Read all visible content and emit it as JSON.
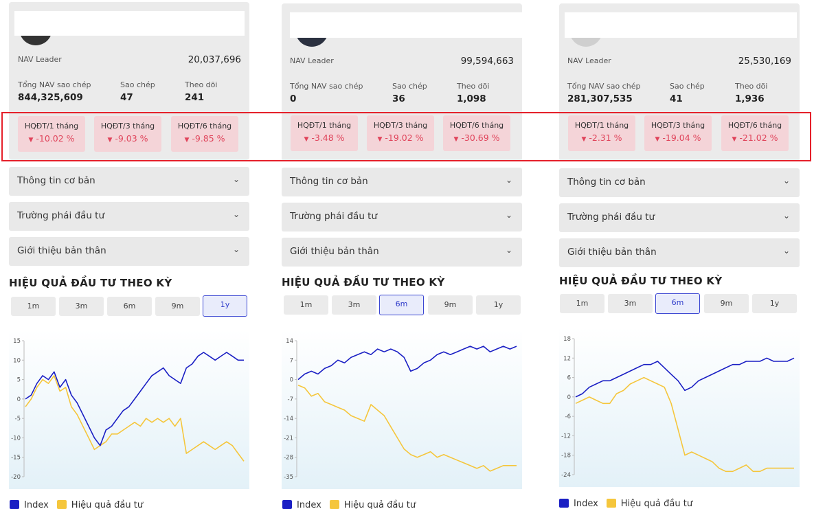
{
  "colors": {
    "index": "#1a1fc4",
    "hqdt": "#f5c63c",
    "negative": "#e0445b",
    "active": "#3b46d2",
    "highlight": "#e5202a"
  },
  "labels": {
    "nav_leader": "NAV Leader",
    "total_nav": "Tổng NAV sao chép",
    "copies": "Sao chép",
    "followers": "Theo dõi",
    "hq1": "HQĐT/1 tháng",
    "hq3": "HQĐT/3 tháng",
    "hq6": "HQĐT/6 tháng",
    "acc_basic": "Thông tin cơ bản",
    "acc_style": "Trường phái đầu tư",
    "acc_intro": "Giới thiệu bản thân",
    "section_title": "HIỆU QUẢ ĐẦU TƯ THEO KỲ",
    "legend_index": "Index",
    "legend_hqdt": "Hiệu quả đầu tư",
    "chevron": "⌄",
    "down_arrow": "▼"
  },
  "periods": [
    "1m",
    "3m",
    "6m",
    "9m",
    "1y"
  ],
  "leaders": [
    {
      "nav_leader": "20,037,696",
      "total_nav": "844,325,609",
      "copies": "47",
      "followers": "241",
      "hq1": "-10.02 %",
      "hq3": "-9.03 %",
      "hq6": "-9.85 %",
      "active_period": "1y"
    },
    {
      "nav_leader": "99,594,663",
      "total_nav": "0",
      "copies": "36",
      "followers": "1,098",
      "hq1": "-3.48 %",
      "hq3": "-19.02 %",
      "hq6": "-30.69 %",
      "active_period": "6m"
    },
    {
      "nav_leader": "25,530,169",
      "total_nav": "281,307,535",
      "copies": "41",
      "followers": "1,936",
      "hq1": "-2.31 %",
      "hq3": "-19.04 %",
      "hq6": "-21.02 %",
      "active_period": "6m"
    }
  ],
  "chart_data": [
    {
      "type": "line",
      "ylim": [
        -20,
        15
      ],
      "yticks": [
        15,
        10,
        5,
        0,
        -5,
        -10,
        -15,
        -20
      ],
      "series": [
        {
          "name": "Index",
          "values": [
            0,
            1,
            4,
            6,
            5,
            7,
            3,
            5,
            1,
            -1,
            -4,
            -7,
            -10,
            -12,
            -8,
            -7,
            -5,
            -3,
            -2,
            0,
            2,
            4,
            6,
            7,
            8,
            6,
            5,
            4,
            8,
            9,
            11,
            12,
            11,
            10,
            11,
            12,
            11,
            10,
            10
          ]
        },
        {
          "name": "Hiệu quả đầu tư",
          "values": [
            -2,
            0,
            3,
            5,
            4,
            6,
            2,
            3,
            -2,
            -4,
            -7,
            -10,
            -13,
            -12,
            -11,
            -9,
            -9,
            -8,
            -7,
            -6,
            -7,
            -5,
            -6,
            -5,
            -6,
            -5,
            -7,
            -5,
            -14,
            -13,
            -12,
            -11,
            -12,
            -13,
            -12,
            -11,
            -12,
            -14,
            -16
          ]
        }
      ]
    },
    {
      "type": "line",
      "ylim": [
        -35,
        14
      ],
      "yticks": [
        14,
        7,
        0,
        -7,
        -14,
        -21,
        -28,
        -35
      ],
      "series": [
        {
          "name": "Index",
          "values": [
            0,
            2,
            3,
            2,
            4,
            5,
            7,
            6,
            8,
            9,
            10,
            9,
            11,
            10,
            11,
            10,
            8,
            3,
            4,
            6,
            7,
            9,
            10,
            9,
            10,
            11,
            12,
            11,
            12,
            10,
            11,
            12,
            11,
            12
          ]
        },
        {
          "name": "Hiệu quả đầu tư",
          "values": [
            -2,
            -3,
            -6,
            -5,
            -8,
            -9,
            -10,
            -11,
            -13,
            -14,
            -15,
            -9,
            -11,
            -13,
            -17,
            -21,
            -25,
            -27,
            -28,
            -27,
            -26,
            -28,
            -27,
            -28,
            -29,
            -30,
            -31,
            -32,
            -31,
            -33,
            -32,
            -31,
            -31,
            -31
          ]
        }
      ]
    },
    {
      "type": "line",
      "ylim": [
        -24,
        18
      ],
      "yticks": [
        18,
        12,
        6,
        0,
        -6,
        -12,
        -18,
        -24
      ],
      "series": [
        {
          "name": "Index",
          "values": [
            0,
            1,
            3,
            4,
            5,
            5,
            6,
            7,
            8,
            9,
            10,
            10,
            11,
            9,
            7,
            5,
            2,
            3,
            5,
            6,
            7,
            8,
            9,
            10,
            10,
            11,
            11,
            11,
            12,
            11,
            11,
            11,
            12
          ]
        },
        {
          "name": "Hiệu quả đầu tư",
          "values": [
            -2,
            -1,
            0,
            -1,
            -2,
            -2,
            1,
            2,
            4,
            5,
            6,
            5,
            4,
            3,
            -2,
            -10,
            -18,
            -17,
            -18,
            -19,
            -20,
            -22,
            -23,
            -23,
            -22,
            -21,
            -23,
            -23,
            -22,
            -22,
            -22,
            -22,
            -22
          ]
        }
      ]
    }
  ]
}
